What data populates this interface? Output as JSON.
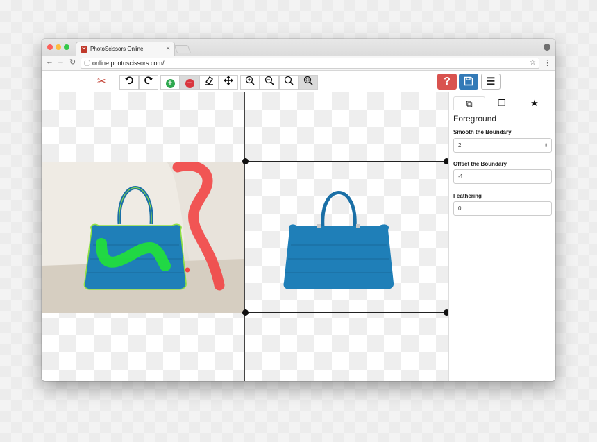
{
  "browser": {
    "tab_title": "PhotoScissors Online",
    "tab_close": "×",
    "url": "online.photoscissors.com/",
    "icons": {
      "back": "back-arrow-icon",
      "forward": "forward-arrow-icon",
      "reload": "reload-icon",
      "info": "info-icon",
      "bookmark": "star-outline-icon",
      "menu": "vertical-dots-icon",
      "profile": "profile-icon"
    }
  },
  "toolbar": {
    "tools": [
      "undo",
      "redo",
      "foreground-marker",
      "background-marker",
      "eraser",
      "pan",
      "zoom-in",
      "zoom-out",
      "zoom-actual-size",
      "zoom-fit"
    ],
    "active_tool": "background-marker",
    "colors": {
      "help": "#d9534f",
      "save": "#337ab7",
      "foreground_marker": "#2fa84f",
      "background_marker": "#d9363e"
    }
  },
  "canvas": {
    "foreground_stroke_color": "#22e03a",
    "background_stroke_color": "#f24545",
    "bag_color": "#1f7fb8"
  },
  "panel": {
    "tabs": [
      "foreground-tab",
      "background-tab",
      "favorites-tab"
    ],
    "section_title": "Foreground",
    "smooth_label": "Smooth the Boundary",
    "smooth_value": "2",
    "offset_label": "Offset the Boundary",
    "offset_value": "-1",
    "feather_label": "Feathering",
    "feather_value": "0"
  }
}
